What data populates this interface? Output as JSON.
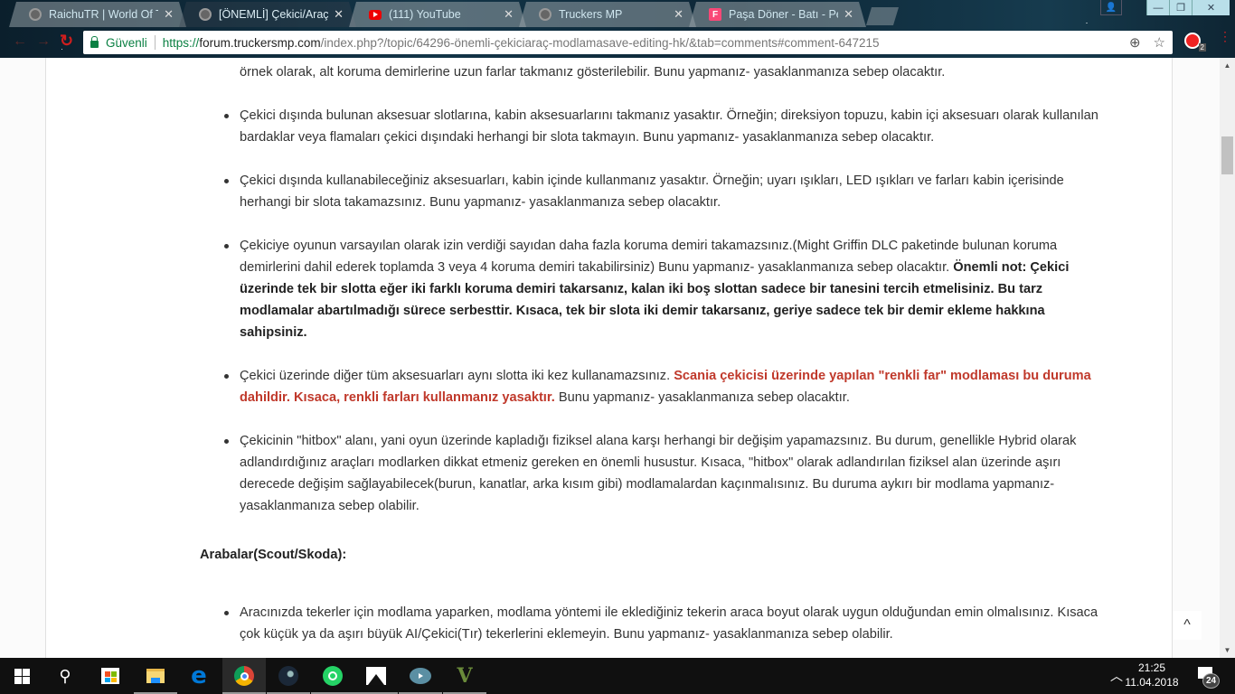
{
  "browser": {
    "tabs": [
      {
        "title": "RaichuTR | World Of Truc",
        "favicon": "gear-icon",
        "active": false
      },
      {
        "title": "[ÖNEMLİ] Çekici/Araç Mo",
        "favicon": "gear-icon",
        "active": true
      },
      {
        "title": "(111) YouTube",
        "favicon": "youtube-icon",
        "active": false
      },
      {
        "title": "Truckers MP",
        "favicon": "gear-icon",
        "active": false
      },
      {
        "title": "Paşa Döner - Batı - Pend",
        "favicon": "foursquare-icon",
        "active": false
      }
    ],
    "tab_close_glyph": "✕",
    "secure_label": "Güvenli",
    "url": {
      "scheme": "https://",
      "host": "forum.truckersmp.com",
      "path": "/index.php?/topic/64296-önemli-çekiciaraç-modlamasave-editing-hk/&tab=comments#comment-647215"
    },
    "extension_badge": "2",
    "window_controls": {
      "minimize": "—",
      "restore": "❐",
      "close": "✕"
    }
  },
  "article": {
    "partial_top_line": "örnek olarak, alt koruma demirlerine uzun farlar takmanız gösterilebilir. Bunu yapmanız- yasaklanmanıza sebep olacaktır.",
    "items": [
      {
        "segments": [
          {
            "style": "normal",
            "text": "Çekici dışında bulunan aksesuar slotlarına, kabin aksesuarlarını takmanız yasaktır. Örneğin; direksiyon topuzu, kabin içi aksesuarı olarak kullanılan bardaklar veya flamaları çekici dışındaki herhangi bir slota takmayın. Bunu yapmanız- yasaklanmanıza sebep olacaktır."
          }
        ]
      },
      {
        "segments": [
          {
            "style": "normal",
            "text": "Çekici dışında kullanabileceğiniz aksesuarları, kabin içinde kullanmanız yasaktır. Örneğin; uyarı ışıkları, LED ışıkları ve farları kabin içerisinde herhangi bir slota takamazsınız. Bunu yapmanız- yasaklanmanıza sebep olacaktır."
          }
        ]
      },
      {
        "segments": [
          {
            "style": "normal",
            "text": "Çekiciye oyunun varsayılan olarak izin verdiği sayıdan daha fazla koruma demiri takamazsınız.(Might Griffin DLC paketinde bulunan koruma demirlerini dahil ederek toplamda 3 veya 4 koruma demiri takabilirsiniz) Bunu yapmanız- yasaklanmanıza sebep olacaktır. "
          },
          {
            "style": "bold",
            "text": "Önemli not: Çekici üzerinde tek bir slotta eğer iki farklı koruma demiri takarsanız, kalan iki boş slottan sadece bir tanesini tercih etmelisiniz. Bu tarz modlamalar abartılmadığı sürece serbesttir. Kısaca, tek bir slota iki demir takarsanız, geriye sadece tek bir demir ekleme hakkına sahipsiniz."
          }
        ]
      },
      {
        "segments": [
          {
            "style": "normal",
            "text": "Çekici üzerinde diğer tüm aksesuarları aynı slotta iki kez kullanamazsınız. "
          },
          {
            "style": "red",
            "text": "Scania çekicisi üzerinde yapılan \"renkli far\" modlaması bu duruma dahildir. Kısaca, renkli farları kullanmanız yasaktır."
          },
          {
            "style": "normal",
            "text": " Bunu yapmanız- yasaklanmanıza sebep olacaktır."
          }
        ]
      },
      {
        "segments": [
          {
            "style": "normal",
            "text": "Çekicinin \"hitbox\" alanı, yani oyun üzerinde kapladığı fiziksel alana karşı herhangi bir değişim yapamazsınız. Bu durum, genellikle Hybrid olarak adlandırdığınız araçları modlarken dikkat etmeniz gereken en önemli husustur. Kısaca, \"hitbox\" olarak adlandırılan fiziksel alan üzerinde aşırı derecede değişim sağlayabilecek(burun, kanatlar, arka kısım gibi) modlamalardan kaçınmalısınız. Bu duruma aykırı bir modlama yapmanız- yasaklanmanıza sebep olabilir."
          }
        ]
      }
    ],
    "section_heading": "Arabalar(Scout/Skoda):",
    "section_items": [
      {
        "segments": [
          {
            "style": "normal",
            "text": "Aracınızda tekerler için modlama yaparken, modlama yöntemi ile eklediğiniz tekerin araca boyut olarak uygun olduğundan emin olmalısınız. Kısaca çok küçük ya da aşırı büyük AI/Çekici(Tır) tekerlerini eklemeyin. Bunu yapmanız- yasaklanmanıza sebep olabilir."
          }
        ]
      }
    ],
    "colors": {
      "text": "#333333",
      "highlight_red": "#c0392b"
    }
  },
  "scroll_top_glyph": "^",
  "taskbar": {
    "apps": [
      "start-icon",
      "search-icon",
      "store-icon",
      "file-explorer-icon",
      "edge-icon",
      "chrome-icon",
      "steam-icon",
      "whatsapp-icon",
      "photos-icon",
      "chat-bubble-icon",
      "gta-v-icon"
    ],
    "time": "21:25",
    "date": "11.04.2018",
    "notification_count": "24"
  }
}
